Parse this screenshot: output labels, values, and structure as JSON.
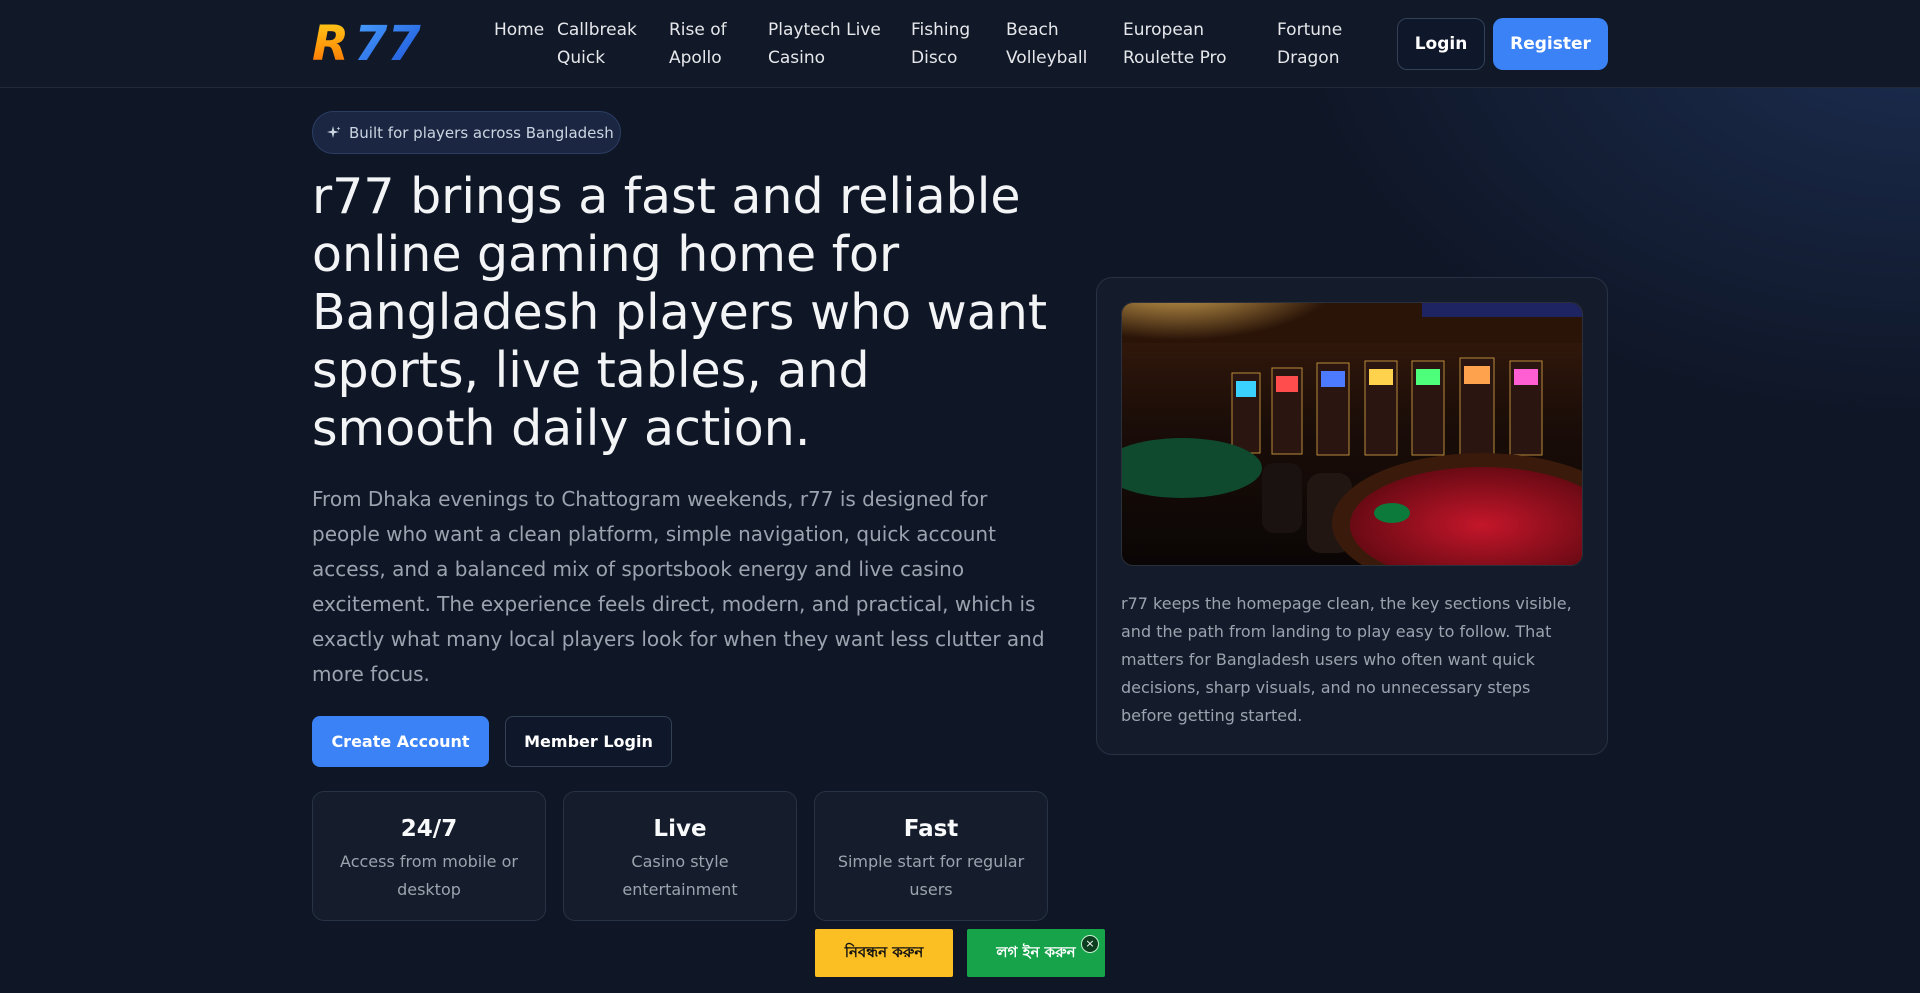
{
  "header": {
    "logo_text": "R77",
    "nav": [
      {
        "label": "Home"
      },
      {
        "label": "Callbreak Quick"
      },
      {
        "label": "Rise of Apollo"
      },
      {
        "label": "Playtech Live Casino"
      },
      {
        "label": "Fishing Disco"
      },
      {
        "label": "Beach Volleyball"
      },
      {
        "label": "European Roulette Pro"
      },
      {
        "label": "Fortune Dragon"
      }
    ],
    "login_label": "Login",
    "register_label": "Register"
  },
  "hero": {
    "badge_icon": "sparkle-icon",
    "badge": "Built for players across Bangladesh",
    "title": "r77 brings a fast and reliable online gaming home for Bangladesh players who want sports, live tables, and smooth daily action.",
    "description": "From Dhaka evenings to Chattogram weekends, r77 is designed for people who want a clean platform, simple navigation, quick account access, and a balanced mix of sportsbook energy and live casino excitement. The experience feels direct, modern, and practical, which is exactly what many local players look for when they want less clutter and more focus.",
    "create_account_label": "Create Account",
    "member_login_label": "Member Login",
    "stats": [
      {
        "value": "24/7",
        "label": "Access from mobile or desktop"
      },
      {
        "value": "Live",
        "label": "Casino style entertainment"
      },
      {
        "value": "Fast",
        "label": "Simple start for regular users"
      }
    ]
  },
  "card": {
    "text": "r77 keeps the homepage clean, the key sections visible, and the path from landing to play easy to follow. That matters for Bangladesh users who often want quick decisions, sharp visuals, and no unnecessary steps before getting started."
  },
  "floating": {
    "register_label": "নিবন্ধন করুন",
    "login_label": "লগ ইন করুন",
    "close_label": "×"
  },
  "colors": {
    "accent": "#3b82f6",
    "background": "#0f1626",
    "floating_register": "#fbbf24",
    "floating_login": "#16a34a"
  }
}
